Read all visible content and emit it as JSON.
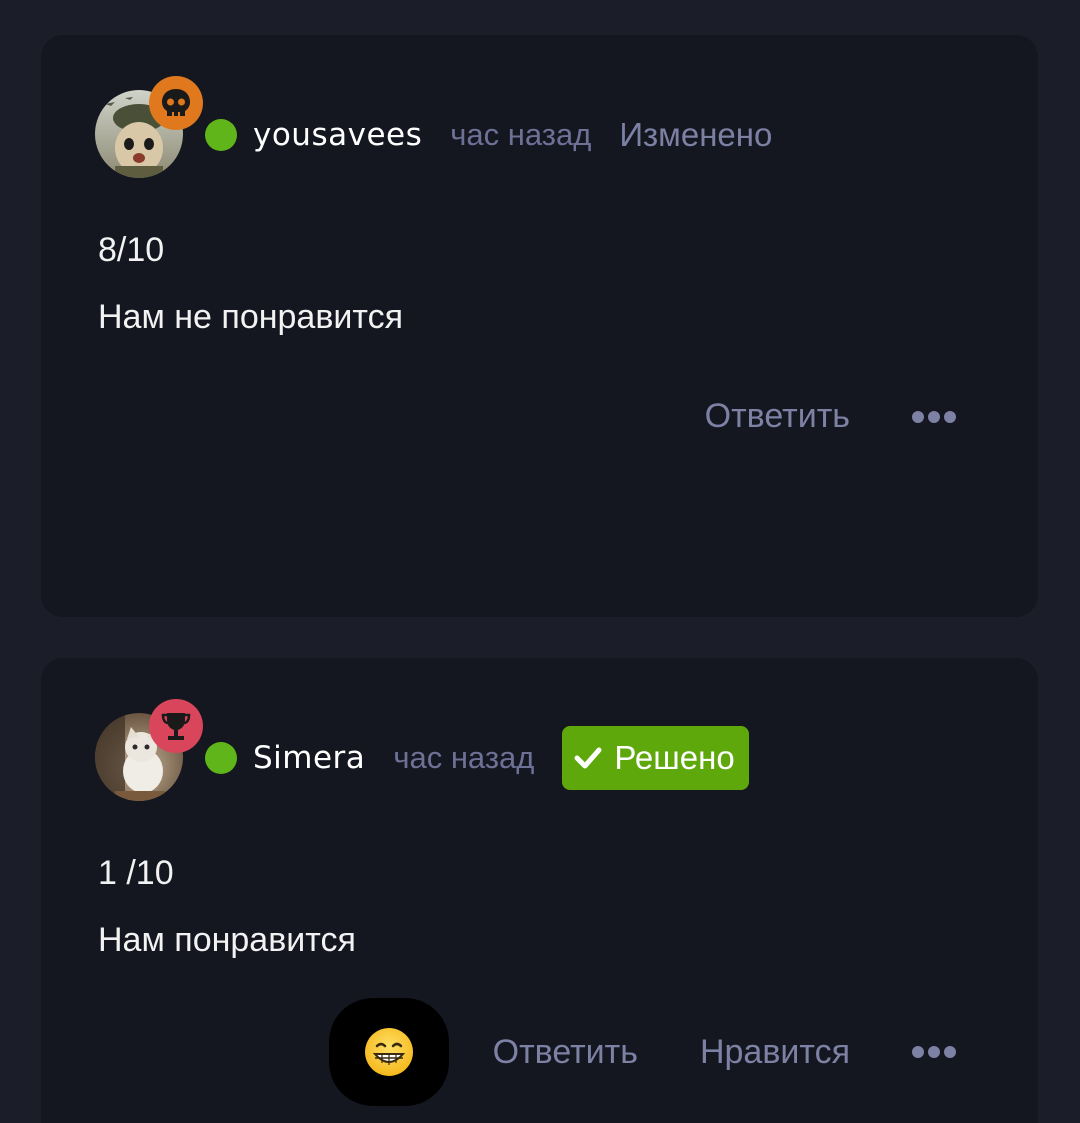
{
  "posts": [
    {
      "username": "yousavees",
      "time": "час назад",
      "edited_label": "Изменено",
      "score": "8/10",
      "comment": "Нам не понравится",
      "reply_label": "Ответить",
      "badge_icon": "skull-icon",
      "badge_color": "#e0781d",
      "online_color": "#5fb51a"
    },
    {
      "username": "Simera",
      "time": "час назад",
      "solved_label": "Решено",
      "score": "1 /10",
      "comment": "Нам понравится",
      "reply_label": "Ответить",
      "like_label": "Нравится",
      "badge_icon": "trophy-icon",
      "badge_color": "#d9455a",
      "online_color": "#5fb51a",
      "solved_color": "#5fa80c",
      "reaction_icon": "grinning-face-emoji"
    }
  ]
}
